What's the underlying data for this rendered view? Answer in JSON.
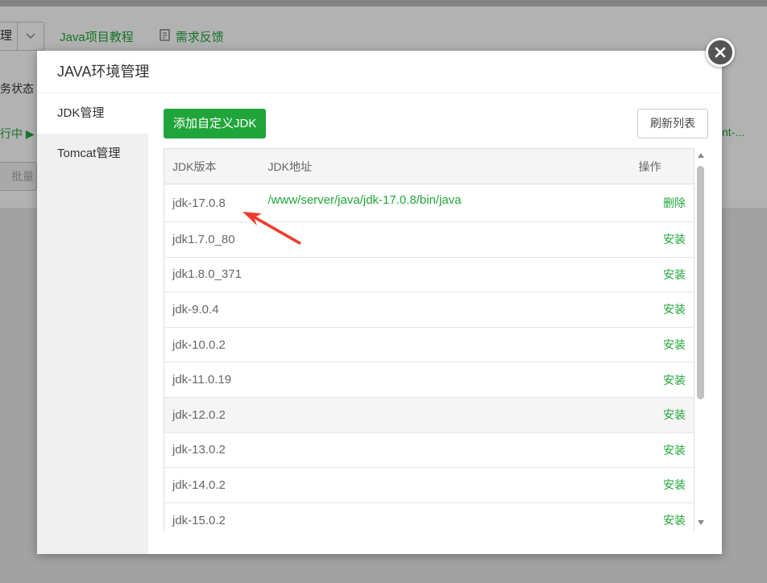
{
  "background": {
    "select_text": "理",
    "tutorial_link": "Java项目教程",
    "feedback_link": "需求反馈",
    "status_label": "务状态",
    "running_label": "行中 ▶",
    "right_text": "nt-...",
    "batch_button": "批量"
  },
  "dialog": {
    "title": "JAVA环境管理",
    "sidebar": [
      {
        "label": "JDK管理",
        "active": true
      },
      {
        "label": "Tomcat管理",
        "active": false
      }
    ],
    "add_button": "添加自定义JDK",
    "refresh_button": "刷新列表",
    "table": {
      "headers": {
        "version": "JDK版本",
        "path": "JDK地址",
        "action": "操作"
      },
      "rows": [
        {
          "version": "jdk-17.0.8",
          "path": "/www/server/java/jdk-17.0.8/bin/java",
          "action": "删除"
        },
        {
          "version": "jdk1.7.0_80",
          "path": "",
          "action": "安装"
        },
        {
          "version": "jdk1.8.0_371",
          "path": "",
          "action": "安装"
        },
        {
          "version": "jdk-9.0.4",
          "path": "",
          "action": "安装"
        },
        {
          "version": "jdk-10.0.2",
          "path": "",
          "action": "安装"
        },
        {
          "version": "jdk-11.0.19",
          "path": "",
          "action": "安装"
        },
        {
          "version": "jdk-12.0.2",
          "path": "",
          "action": "安装"
        },
        {
          "version": "jdk-13.0.2",
          "path": "",
          "action": "安装"
        },
        {
          "version": "jdk-14.0.2",
          "path": "",
          "action": "安装"
        },
        {
          "version": "jdk-15.0.2",
          "path": "",
          "action": "安装"
        }
      ]
    }
  },
  "colors": {
    "accent": "#20a53a",
    "annotation": "#ef3b2c"
  }
}
